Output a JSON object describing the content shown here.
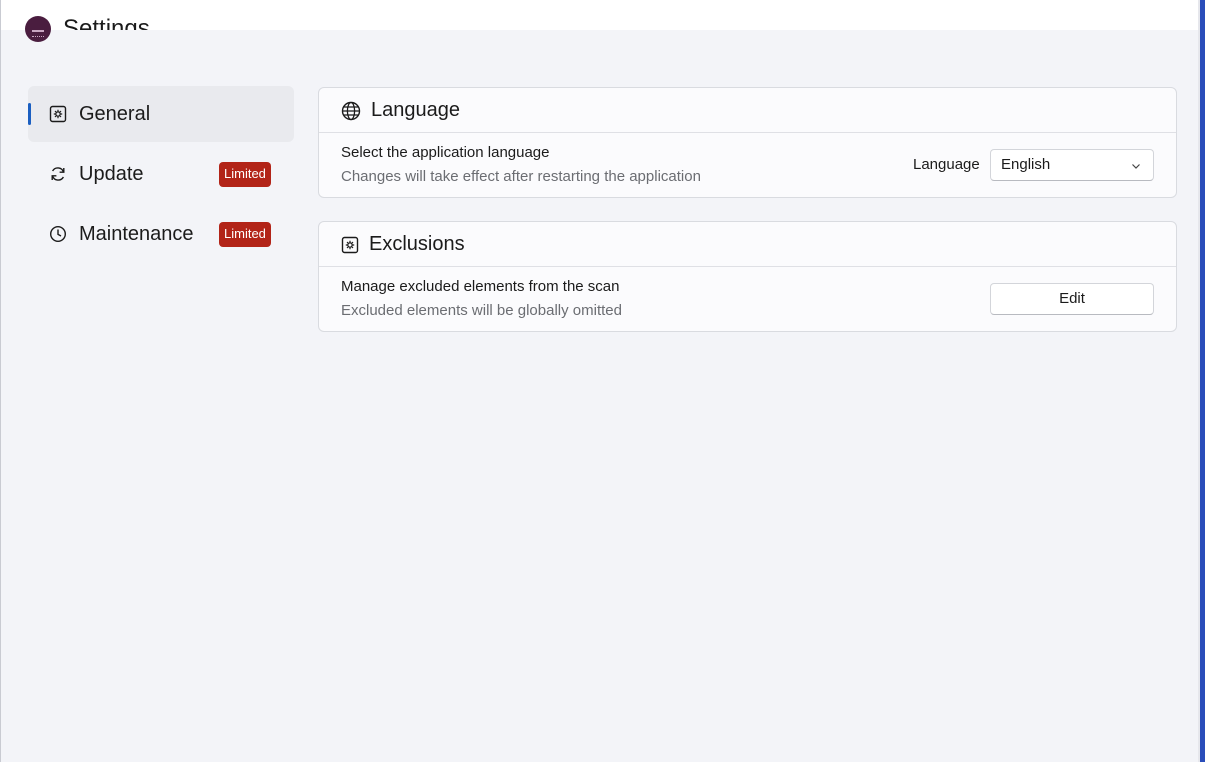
{
  "app": {
    "title": "Settings"
  },
  "sidebar": {
    "items": [
      {
        "label": "General",
        "icon": "gear-icon",
        "active": true,
        "badge": ""
      },
      {
        "label": "Update",
        "icon": "refresh-icon",
        "active": false,
        "badge": "Limited"
      },
      {
        "label": "Maintenance",
        "icon": "clock-icon",
        "active": false,
        "badge": "Limited"
      }
    ]
  },
  "language_card": {
    "title": "Language",
    "icon": "globe-icon",
    "row_title": "Select the application language",
    "row_subtitle": "Changes will take effect after restarting the application",
    "select_label": "Language",
    "selected_value": "English"
  },
  "exclusions_card": {
    "title": "Exclusions",
    "icon": "gear-icon",
    "row_title": "Manage excluded elements from the scan",
    "row_subtitle": "Excluded elements will be globally omitted",
    "button_label": "Edit"
  },
  "colors": {
    "accent": "#1b5fc1",
    "badge": "#b22418",
    "background": "#f3f4f8",
    "card": "#fbfbfd"
  }
}
